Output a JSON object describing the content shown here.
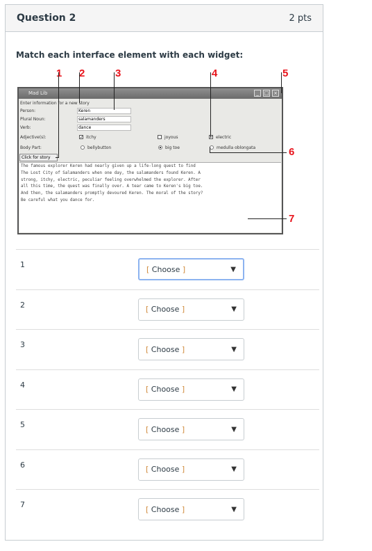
{
  "question": {
    "title": "Question 2",
    "points": "2 pts",
    "prompt": "Match each interface element with each widget:"
  },
  "figure": {
    "callouts": [
      "1",
      "2",
      "3",
      "4",
      "5",
      "6",
      "7"
    ],
    "window_title": "Mad Lib",
    "intro": "Enter information for a new story",
    "labels": {
      "person": "Person:",
      "plural": "Plural Noun:",
      "verb": "Verb:",
      "adj": "Adjective(s):",
      "body": "Body Part:"
    },
    "values": {
      "person": "Keren",
      "plural": "salamanders",
      "verb": "dance"
    },
    "adjectives": [
      {
        "label": "itchy",
        "checked": true
      },
      {
        "label": "joyous",
        "checked": false
      },
      {
        "label": "electric",
        "checked": true
      }
    ],
    "body_parts": [
      {
        "label": "bellybutton",
        "selected": false
      },
      {
        "label": "big toe",
        "selected": true
      },
      {
        "label": "medulla oblongata",
        "selected": false
      }
    ],
    "button": "Click for story",
    "story": "The famous explorer Keren had nearly given up a life-long quest to find\nThe Lost City of Salamanders when one day, the salamanders found Keren. A\nstrong, itchy, electric, peculiar feeling overwhelmed the explorer. After\nall this time, the quest was finally over. A tear came to Keren's big toe.\nAnd then, the salamanders promptly devoured Keren. The moral of the story?\nBe careful what you dance for."
  },
  "rows": [
    {
      "label": "1"
    },
    {
      "label": "2"
    },
    {
      "label": "3"
    },
    {
      "label": "4"
    },
    {
      "label": "5"
    },
    {
      "label": "6"
    },
    {
      "label": "7"
    }
  ],
  "select": {
    "open": "[",
    "text": " Choose ",
    "close": "]",
    "arrow": "▼"
  }
}
